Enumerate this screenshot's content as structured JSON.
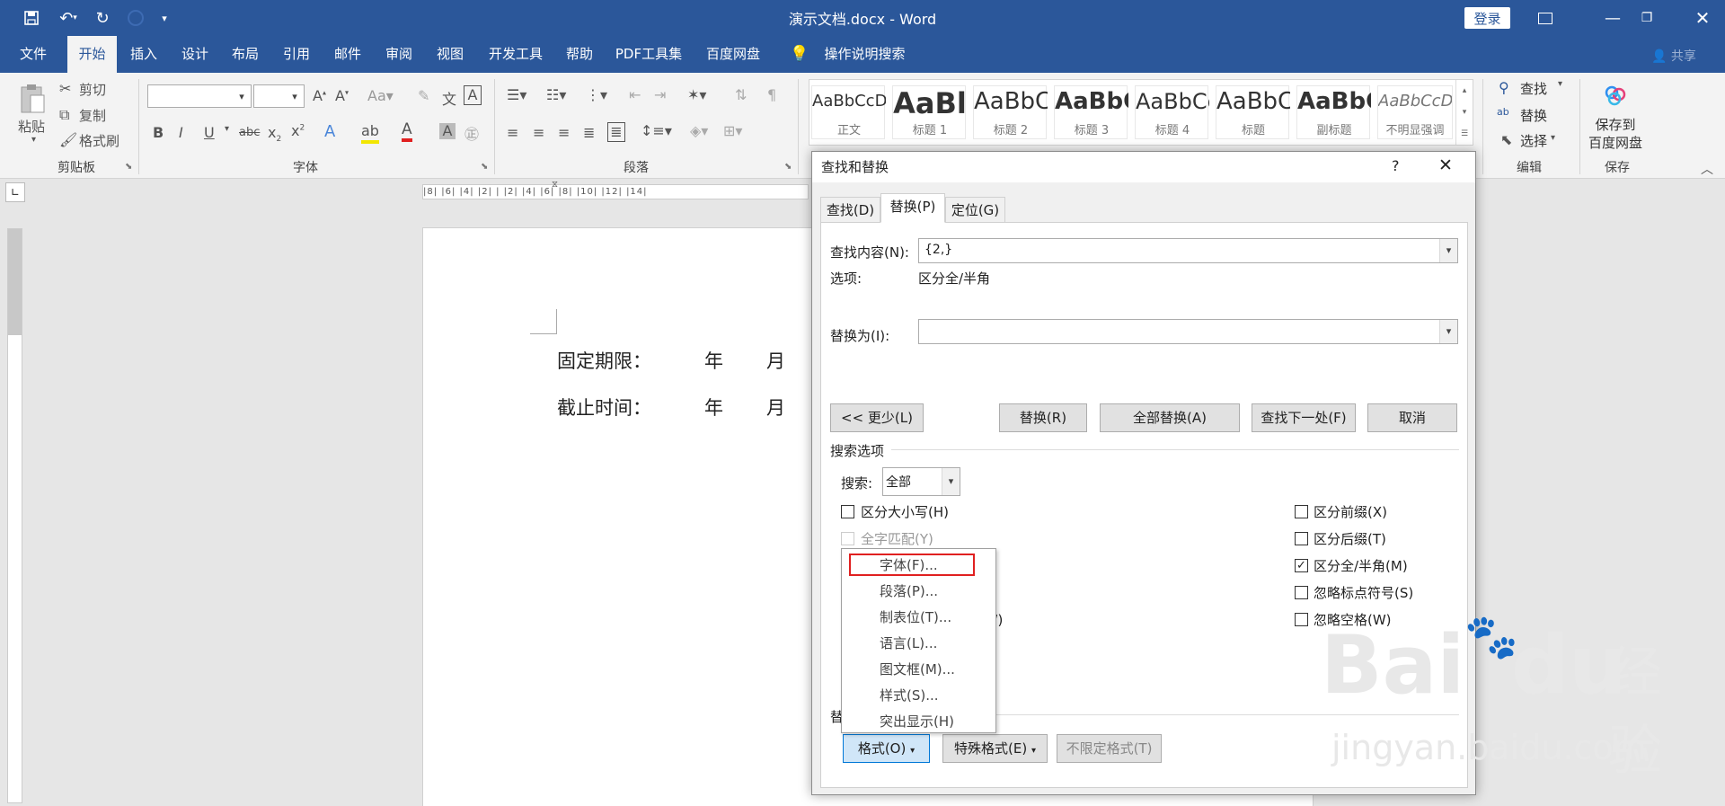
{
  "window": {
    "title": "演示文档.docx - Word",
    "login": "登录"
  },
  "ribbon_tabs": [
    "文件",
    "开始",
    "插入",
    "设计",
    "布局",
    "引用",
    "邮件",
    "审阅",
    "视图",
    "开发工具",
    "帮助",
    "PDF工具集",
    "百度网盘"
  ],
  "search_hint": "操作说明搜索",
  "share": "共享",
  "clipboard": {
    "paste": "粘贴",
    "cut": "剪切",
    "copy": "复制",
    "format_painter": "格式刷",
    "group": "剪贴板"
  },
  "font_group": {
    "group": "字体"
  },
  "paragraph_group": {
    "group": "段落"
  },
  "styles": [
    {
      "sample": "AaBbCcDd",
      "name": "正文"
    },
    {
      "sample": "AaBl",
      "name": "标题 1"
    },
    {
      "sample": "AaBbC",
      "name": "标题 2"
    },
    {
      "sample": "AaBbC",
      "name": "标题 3"
    },
    {
      "sample": "AaBbCc",
      "name": "标题 4"
    },
    {
      "sample": "AaBbC",
      "name": "标题"
    },
    {
      "sample": "AaBbC",
      "name": "副标题"
    },
    {
      "sample": "AaBbCcDd",
      "name": "不明显强调"
    }
  ],
  "editing": {
    "find": "查找",
    "replace": "替换",
    "select": "选择",
    "group": "编辑"
  },
  "save_group": {
    "label_line1": "保存到",
    "label_line2": "百度网盘",
    "group": "保存"
  },
  "ruler_text": "|8| |6| |4| |2| |  |2| |4| |6| |8| |10| |12| |14|",
  "document": {
    "line1": {
      "label": "固定期限：",
      "year": "年",
      "month": "月"
    },
    "line2": {
      "label": "截止时间：",
      "year": "年",
      "month": "月"
    }
  },
  "dialog": {
    "title": "查找和替换",
    "help": "?",
    "tabs": [
      "查找(D)",
      "替换(P)",
      "定位(G)"
    ],
    "find_label": "查找内容(N):",
    "find_value": "{2,}",
    "options_label": "选项:",
    "options_value": "区分全/半角",
    "replace_label": "替换为(I):",
    "replace_value": "",
    "buttons": {
      "less": "<< 更少(L)",
      "replace": "替换(R)",
      "replace_all": "全部替换(A)",
      "find_next": "查找下一处(F)",
      "cancel": "取消"
    },
    "search_options_title": "搜索选项",
    "search_label": "搜索:",
    "search_value": "全部",
    "checks_left": [
      {
        "label": "区分大小写(H)",
        "checked": false,
        "disabled": false
      },
      {
        "label": "全字匹配(Y)",
        "checked": false,
        "disabled": true
      }
    ],
    "check_left_partial": "文)(W)",
    "checks_right": [
      {
        "label": "区分前缀(X)",
        "checked": false
      },
      {
        "label": "区分后缀(T)",
        "checked": false
      },
      {
        "label": "区分全/半角(M)",
        "checked": true
      },
      {
        "label": "忽略标点符号(S)",
        "checked": false
      },
      {
        "label": "忽略空格(W)",
        "checked": false
      }
    ],
    "replace_section_partial": "替",
    "format_button": "格式(O)",
    "special_button": "特殊格式(E)",
    "no_format_button": "不限定格式(T)"
  },
  "format_menu": [
    "字体(F)...",
    "段落(P)...",
    "制表位(T)...",
    "语言(L)...",
    "图文框(M)...",
    "样式(S)...",
    "突出显示(H)"
  ],
  "watermark": {
    "brand": "Bai",
    "brand2": "du",
    "cn": "经验",
    "url": "jingyan.baidu.com"
  },
  "colors": {
    "word_blue": "#2b579a",
    "highlight_red": "#e02020",
    "accent": "#0078d7"
  }
}
